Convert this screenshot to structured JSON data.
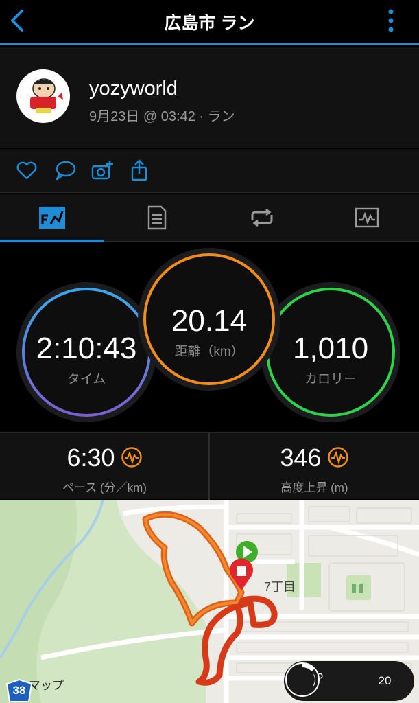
{
  "header": {
    "title": "広島市 ラン",
    "accent": "#1f8dd6"
  },
  "profile": {
    "username": "yozyworld",
    "meta": "9月23日 @ 03:42 · ラン"
  },
  "actions": [
    "heart-icon",
    "comment-icon",
    "add-photo-icon",
    "share-icon"
  ],
  "tabs": [
    {
      "icon": "summary-chart-icon",
      "active": true
    },
    {
      "icon": "details-list-icon",
      "active": false
    },
    {
      "icon": "laps-icon",
      "active": false
    },
    {
      "icon": "graph-icon",
      "active": false
    }
  ],
  "stats": {
    "time": {
      "value": "2:10:43",
      "label": "タイム",
      "color": "#5b7fe0"
    },
    "distance": {
      "value": "20.14",
      "label": "距離（km）",
      "color": "#f28c1a"
    },
    "calories": {
      "value": "1,010",
      "label": "カロリー",
      "color": "#2ed14a"
    }
  },
  "metrics": {
    "pace": {
      "value": "6:30",
      "label": "ペース (分／km)"
    },
    "elevation": {
      "value": "346",
      "label": "高度上昇 (m)"
    }
  },
  "map": {
    "area_label": "7丁目",
    "attribution": "マップ",
    "route_number": "38",
    "temperature": "20°",
    "wind": "20"
  }
}
